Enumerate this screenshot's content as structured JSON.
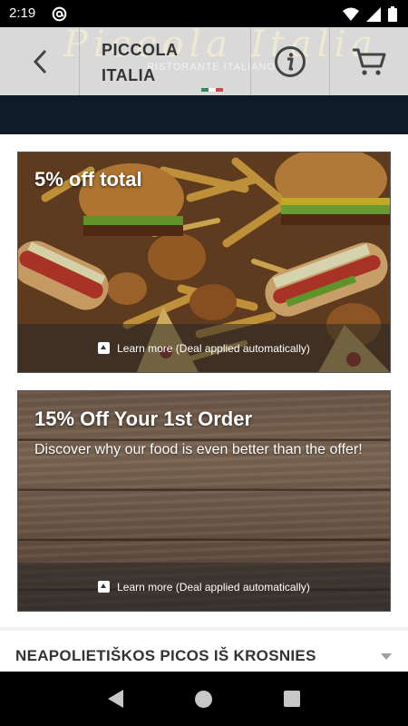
{
  "status_bar": {
    "time": "2:19",
    "app_icon": "at-sign-icon",
    "icons": [
      "wifi-icon",
      "signal-icon",
      "battery-icon"
    ]
  },
  "header": {
    "brand_watermark": "Piccola Italia",
    "brand_sub": "RISTORANTE ITALIANO",
    "title_line1": "PICCOLA",
    "title_line2": "ITALIA",
    "back_icon": "chevron-left-icon",
    "info_icon": "info-icon",
    "cart_icon": "cart-icon",
    "background": "#d9d9d9",
    "flag_colors": [
      "#2e8b57",
      "#ffffff",
      "#d64545"
    ]
  },
  "deals": [
    {
      "title": "5% off total",
      "description": "",
      "learn_more": "Learn more (Deal applied automatically)",
      "background": "food-image"
    },
    {
      "title": "15% Off Your 1st Order",
      "description": "Discover why our food is even better than the offer!",
      "learn_more": "Learn more (Deal applied automatically)",
      "background": "wood-image"
    }
  ],
  "menu_section": {
    "title": "NEAPOLIETIŠKOS PICOS IŠ KROSNIES",
    "chevron": "chevron-down-icon"
  },
  "colors": {
    "dark_band": "#0f1b26",
    "header_text": "#333333"
  },
  "nav_bar": {
    "buttons": [
      "back-triangle-icon",
      "home-circle-icon",
      "recents-square-icon"
    ]
  }
}
